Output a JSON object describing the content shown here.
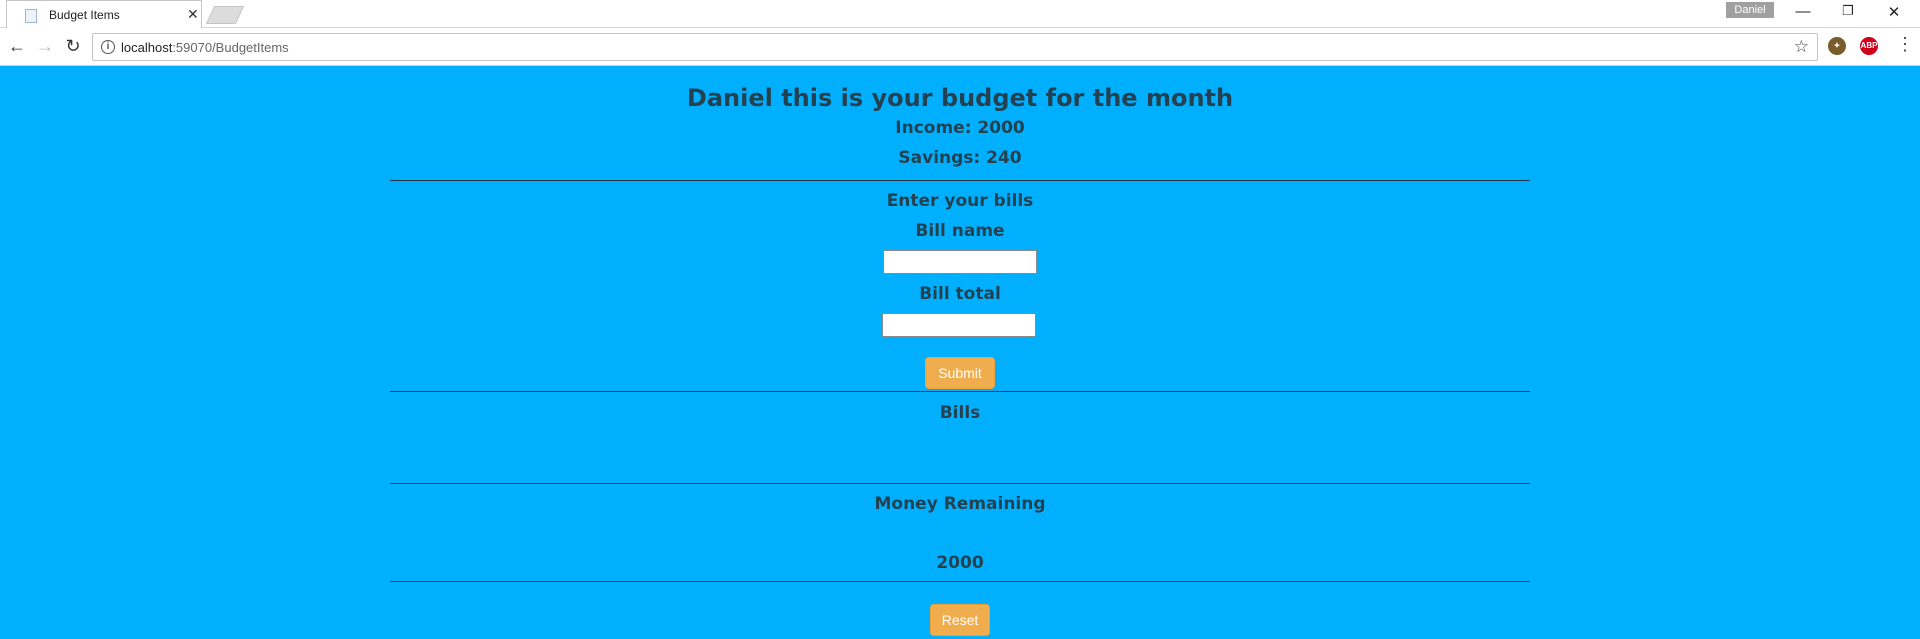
{
  "browser": {
    "tab_title": "Budget Items",
    "profile_name": "Daniel",
    "url_host": "localhost",
    "url_path": ":59070/BudgetItems"
  },
  "page": {
    "heading": "Daniel  this is your budget for the month",
    "income": "Income: 2000",
    "savings": "Savings: 240",
    "enter_bills": "Enter your bills",
    "bill_name_label": "Bill name",
    "bill_name_value": "",
    "bill_total_label": "Bill total",
    "bill_total_value": "",
    "submit_label": "Submit",
    "bills_heading": "Bills",
    "money_remaining_heading": "Money Remaining",
    "money_remaining_value": "2000",
    "reset_label": "Reset"
  },
  "colors": {
    "page_background": "#00b0ff",
    "text": "#24414f",
    "button": "#f0ad4e"
  }
}
